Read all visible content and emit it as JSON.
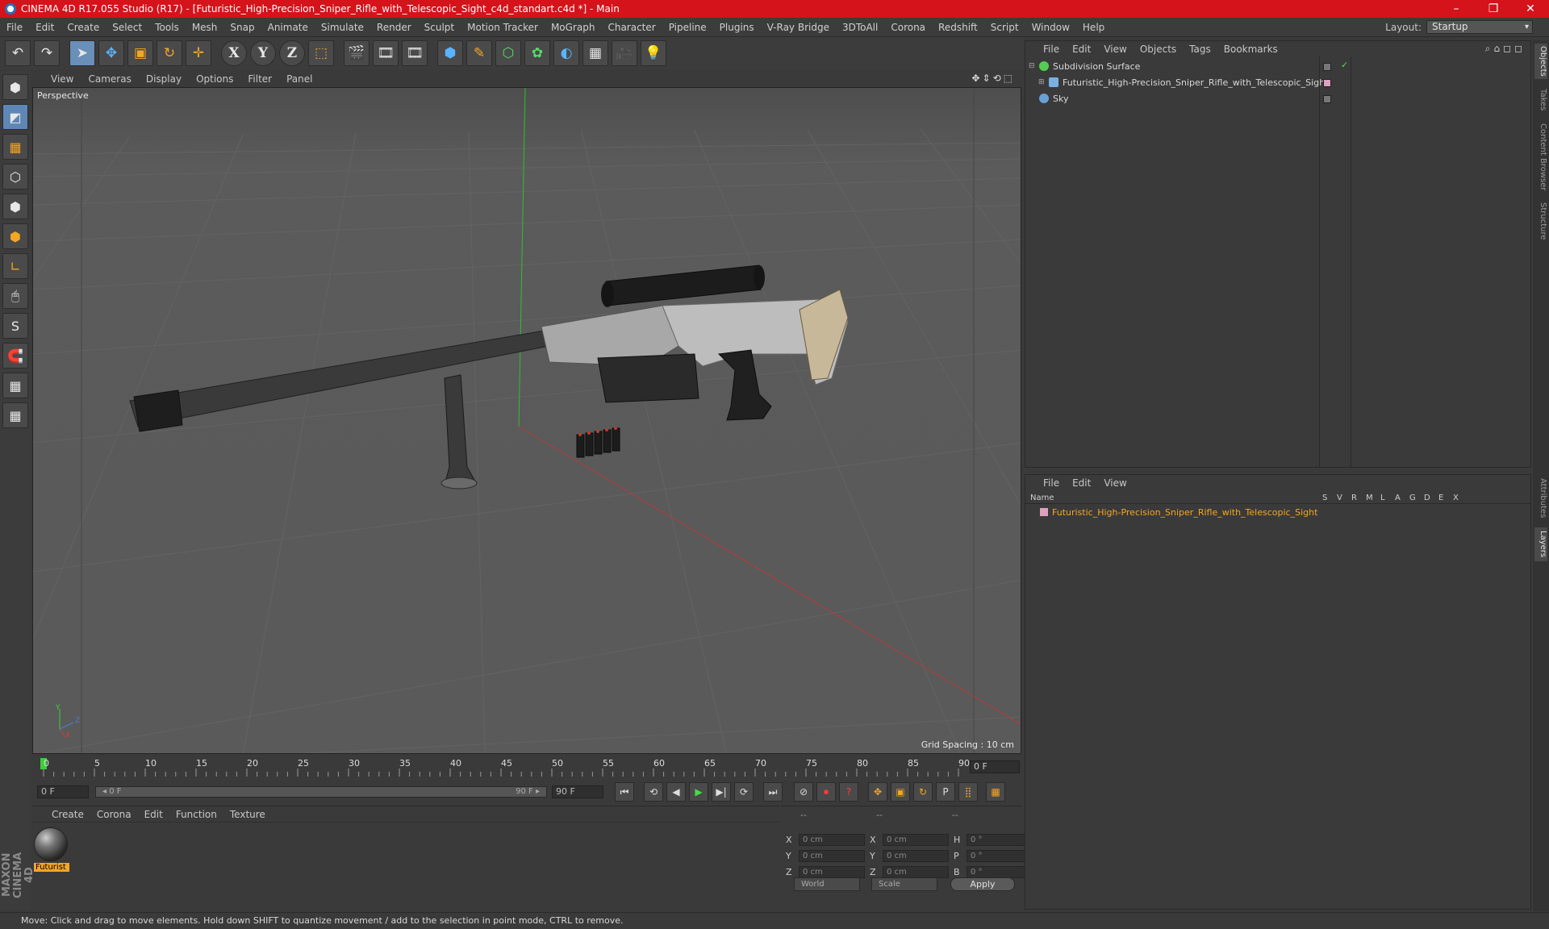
{
  "window": {
    "title": "CINEMA 4D R17.055 Studio (R17) - [Futuristic_High-Precision_Sniper_Rifle_with_Telescopic_Sight_c4d_standart.c4d *] - Main",
    "minimize": "–",
    "maximize": "❐",
    "close": "✕"
  },
  "menu": [
    "File",
    "Edit",
    "Create",
    "Select",
    "Tools",
    "Mesh",
    "Snap",
    "Animate",
    "Simulate",
    "Render",
    "Sculpt",
    "Motion Tracker",
    "MoGraph",
    "Character",
    "Pipeline",
    "Plugins",
    "V-Ray Bridge",
    "3DToAll",
    "Corona",
    "Redshift",
    "Script",
    "Window",
    "Help"
  ],
  "layout": {
    "label": "Layout:",
    "value": "Startup"
  },
  "toolbar": {
    "undo": "↶",
    "redo": "↷",
    "select": "➤",
    "move": "✥",
    "scale": "▣",
    "rotate": "↻",
    "transform": "✛",
    "x": "X",
    "y": "Y",
    "z": "Z",
    "coord": "⬚",
    "render_view": "🎬",
    "render": "🎞",
    "render_settings": "🎞",
    "cube": "⬢",
    "pen": "✎",
    "nurbs": "⬡",
    "cloner": "✿",
    "deformer": "◐",
    "floor": "▦",
    "camera": "🎥",
    "light": "💡"
  },
  "lefttools": [
    "⬢",
    "◩",
    "▦",
    "⬡",
    "⬢",
    "⬢",
    "∟",
    "🖱",
    "S",
    "🧲",
    "▦",
    "▦"
  ],
  "maxon_logo": "MAXON CINEMA 4D",
  "viewport": {
    "menu": [
      "View",
      "Cameras",
      "Display",
      "Options",
      "Filter",
      "Panel"
    ],
    "nav_icons": "✥⇕⟲⬚",
    "label": "Perspective",
    "grid_spacing": "Grid Spacing : 10 cm",
    "axis": {
      "y": "Y",
      "z": "Z",
      "x": "X"
    }
  },
  "timeline": {
    "ticks": [
      "0",
      "5",
      "10",
      "15",
      "20",
      "25",
      "30",
      "35",
      "40",
      "45",
      "50",
      "55",
      "60",
      "65",
      "70",
      "75",
      "80",
      "85",
      "90"
    ],
    "current_frame": "0 F"
  },
  "transport": {
    "start_field": "0 F",
    "range_start": "◂ 0 F",
    "range_end": "90 F ▸",
    "end_field": "90 F",
    "buttons": [
      "⏮",
      "⟲",
      "◀",
      "▶",
      "▶|",
      "⟳",
      "⏭"
    ],
    "keys": [
      "⊘",
      "⏺",
      "?",
      "✥",
      "▣",
      "↻",
      "P",
      "⣿",
      "▦"
    ]
  },
  "materials": {
    "menu": [
      "Create",
      "Corona",
      "Edit",
      "Function",
      "Texture"
    ],
    "items": [
      {
        "name": "Futurist"
      }
    ]
  },
  "coords": {
    "headers": [
      "--",
      "--",
      "--"
    ],
    "rows": [
      {
        "a": "X",
        "av": "0 cm",
        "b": "X",
        "bv": "0 cm",
        "c": "H",
        "cv": "0 °"
      },
      {
        "a": "Y",
        "av": "0 cm",
        "b": "Y",
        "bv": "0 cm",
        "c": "P",
        "cv": "0 °"
      },
      {
        "a": "Z",
        "av": "0 cm",
        "b": "Z",
        "bv": "0 cm",
        "c": "B",
        "cv": "0 °"
      }
    ],
    "world": "World",
    "scale": "Scale",
    "apply": "Apply"
  },
  "status": "Move: Click and drag to move elements. Hold down SHIFT to quantize movement / add to the selection in point mode, CTRL to remove.",
  "objects": {
    "menu": [
      "File",
      "Edit",
      "View",
      "Objects",
      "Tags",
      "Bookmarks"
    ],
    "icons": "⌕⌂◻◻",
    "items": [
      {
        "name": "Subdivision Surface",
        "expander": "⊟",
        "color": "#55cc55"
      },
      {
        "name": "Futuristic_High-Precision_Sniper_Rifle_with_Telescopic_Sight",
        "expander": "⊞",
        "color": "#7ab0e0"
      },
      {
        "name": "Sky",
        "expander": "",
        "color": "#6aa0d8"
      }
    ],
    "check": "✓"
  },
  "layers": {
    "menu": [
      "File",
      "Edit",
      "View"
    ],
    "headers": [
      "Name",
      "S",
      "V",
      "R",
      "M",
      "L",
      "A",
      "G",
      "D",
      "E",
      "X"
    ],
    "items": [
      {
        "name": "Futuristic_High-Precision_Sniper_Rifle_with_Telescopic_Sight"
      }
    ]
  },
  "sidetabs": [
    "Objects",
    "Takes",
    "Content Browser",
    "Structure",
    "Attributes",
    "Layers"
  ]
}
